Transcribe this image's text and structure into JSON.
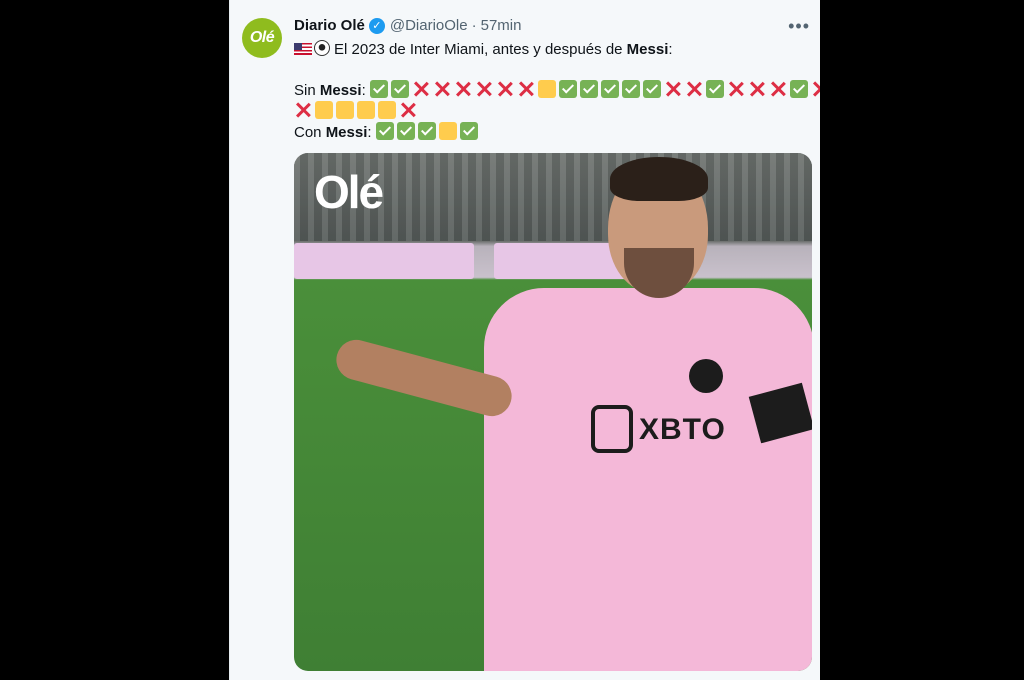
{
  "tweet": {
    "author_name": "Diario Olé",
    "handle": "@DiarioOle",
    "separator": "·",
    "time": "57min",
    "avatar_text": "Olé",
    "more_label": "•••",
    "intro_text": "El 2023 de Inter Miami, antes y después de ",
    "intro_bold": "Messi",
    "intro_end": ":",
    "sin_label": "Sin ",
    "con_label": "Con ",
    "bold_name": "Messi",
    "colon": ": ",
    "sin_line1": [
      "check",
      "check",
      "cross",
      "cross",
      "cross",
      "cross",
      "cross",
      "cross",
      "square",
      "check",
      "check",
      "check",
      "check",
      "check",
      "cross",
      "cross",
      "check",
      "cross",
      "cross",
      "cross",
      "check",
      "cross"
    ],
    "sin_line2": [
      "cross",
      "square",
      "square",
      "square",
      "square",
      "cross"
    ],
    "con_line": [
      "check",
      "check",
      "check",
      "square",
      "check"
    ]
  },
  "media": {
    "watermark": "Olé",
    "sponsor_text": "XBTO"
  },
  "colors": {
    "check": "#77b255",
    "cross": "#dd2e44",
    "square": "#ffcc4d",
    "verified": "#1d9bf0",
    "avatar_bg": "#8fbc1e"
  }
}
